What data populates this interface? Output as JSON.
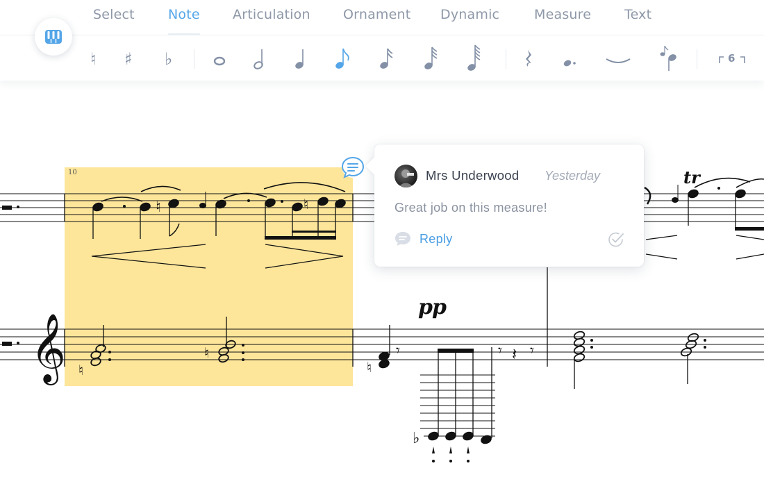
{
  "tabs": [
    {
      "label": "Select",
      "active": false
    },
    {
      "label": "Note",
      "active": true
    },
    {
      "label": "Articulation",
      "active": false
    },
    {
      "label": "Ornament",
      "active": false
    },
    {
      "label": "Dynamic",
      "active": false
    },
    {
      "label": "Measure",
      "active": false
    },
    {
      "label": "Text",
      "active": false
    }
  ],
  "toolbar": {
    "tools": [
      {
        "icon": "natural-icon",
        "char": "♮"
      },
      {
        "icon": "sharp-icon",
        "char": "♯"
      },
      {
        "icon": "flat-icon",
        "char": "♭"
      },
      {
        "icon": "whole-note-icon"
      },
      {
        "icon": "half-note-icon"
      },
      {
        "icon": "quarter-note-icon"
      },
      {
        "icon": "eighth-note-icon",
        "selected": true
      },
      {
        "icon": "sixteenth-note-icon"
      },
      {
        "icon": "thirty-second-note-icon"
      },
      {
        "icon": "sixty-fourth-note-icon"
      },
      {
        "icon": "rest-icon"
      },
      {
        "icon": "dot-icon"
      },
      {
        "icon": "tie-icon"
      },
      {
        "icon": "grace-note-icon"
      },
      {
        "icon": "tuplet-icon",
        "label": "⌐6¬"
      }
    ],
    "tuplet_label": "6",
    "piano_icon": "piano-keyboard-icon"
  },
  "score": {
    "measure_number": "10",
    "dynamic": "pp",
    "ornament": "tr",
    "highlight_color": "#fde59a"
  },
  "comment": {
    "author": "Mrs Underwood",
    "time": "Yesterday",
    "text": "Great job on this measure!",
    "reply_label": "Reply"
  },
  "colors": {
    "accent": "#55a6e8",
    "tab_inactive": "#8e98a8",
    "icon": "#8390a6"
  }
}
